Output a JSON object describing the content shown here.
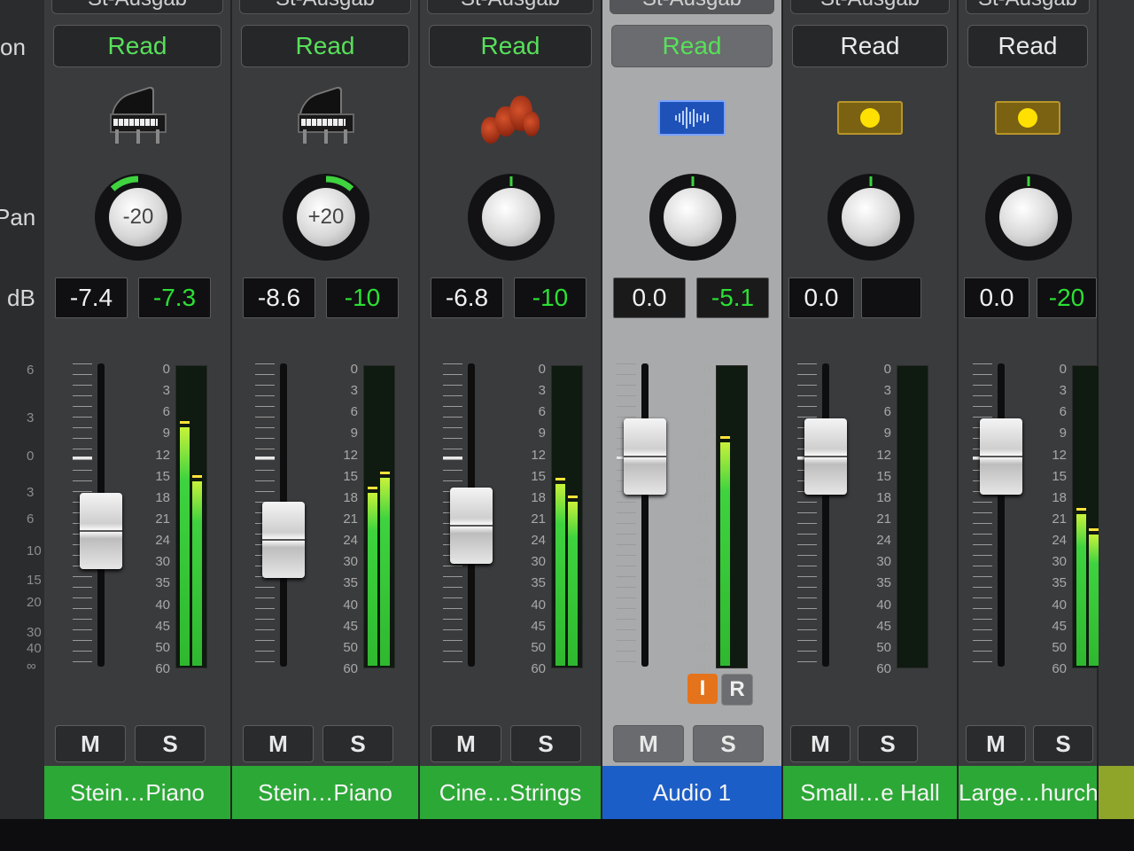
{
  "labels": {
    "on": "on",
    "pan": "Pan",
    "db": "dB"
  },
  "fader_scale": [
    "6",
    "3",
    "0",
    "3",
    "6",
    "10",
    "15",
    "20",
    "30",
    "40",
    "∞"
  ],
  "meter_scale": [
    "0",
    "3",
    "6",
    "9",
    "12",
    "15",
    "18",
    "21",
    "24",
    "30",
    "35",
    "40",
    "45",
    "50",
    "60"
  ],
  "strips": [
    {
      "output": "St-Ausgab",
      "automation": "Read",
      "icon": "piano-icon",
      "pan": "-20",
      "volume": "-7.4",
      "peak": "-7.3",
      "mute": "M",
      "solo": "S",
      "name": "Stein…Piano",
      "name_color": "#2ca836",
      "meter_levels": [
        0.8,
        0.62
      ],
      "fader_level": -7.4
    },
    {
      "output": "St-Ausgab",
      "automation": "Read",
      "icon": "piano-icon",
      "pan": "+20",
      "volume": "-8.6",
      "peak": "-10",
      "mute": "M",
      "solo": "S",
      "name": "Stein…Piano",
      "name_color": "#2ca836",
      "meter_levels": [
        0.58,
        0.63
      ],
      "fader_level": -8.6
    },
    {
      "output": "St-Ausgab",
      "automation": "Read",
      "icon": "strings-icon",
      "pan": "",
      "volume": "-6.8",
      "peak": "-10",
      "mute": "M",
      "solo": "S",
      "name": "Cine…Strings",
      "name_color": "#2ca836",
      "meter_levels": [
        0.61,
        0.55
      ],
      "fader_level": -6.8
    },
    {
      "output": "St-Ausgab",
      "automation": "Read",
      "icon": "waveform-icon",
      "pan": "",
      "volume": "0.0",
      "peak": "-5.1",
      "mute": "M",
      "solo": "S",
      "name": "Audio 1",
      "name_color": "#1c5ec7",
      "meter_levels": [
        0.75,
        0
      ],
      "fader_level": 0.0,
      "input_label": "I",
      "record_label": "R",
      "selected": true
    },
    {
      "output": "St-Ausgab",
      "automation": "Read",
      "icon": "bus-icon",
      "pan": "",
      "volume": "0.0",
      "peak": "",
      "mute": "M",
      "solo": "S",
      "name": "Small…e Hall",
      "name_color": "#2ca836",
      "meter_levels": [
        0,
        0
      ],
      "fader_level": 0.0
    },
    {
      "output": "St-Ausgab",
      "automation": "Read",
      "icon": "bus-icon",
      "pan": "",
      "volume": "0.0",
      "peak": "-20",
      "mute": "M",
      "solo": "S",
      "name": "Large…hurch",
      "name_color": "#2ca836",
      "meter_levels": [
        0.51,
        0.44
      ],
      "fader_level": 0.0
    }
  ]
}
